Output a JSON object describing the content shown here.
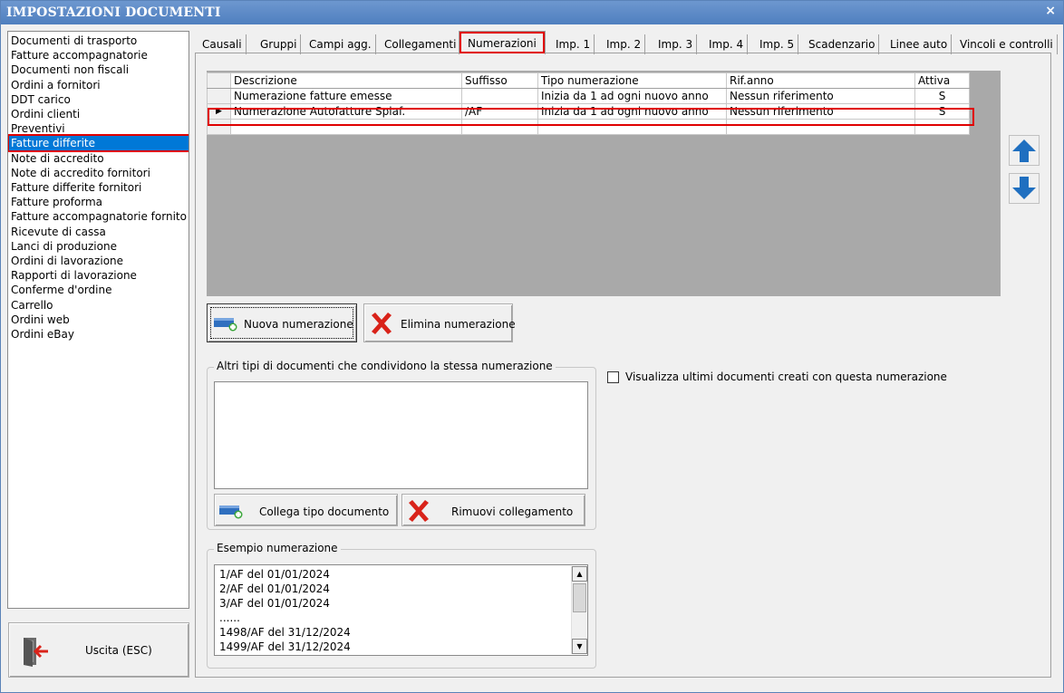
{
  "window": {
    "title": "IMPOSTAZIONI DOCUMENTI",
    "close_glyph": "×"
  },
  "doclist": {
    "items": [
      "Documenti di trasporto",
      "Fatture accompagnatorie",
      "Documenti non fiscali",
      "Ordini a fornitori",
      "DDT carico",
      "Ordini clienti",
      "Preventivi",
      "Fatture differite",
      "Note di accredito",
      "Note di accredito fornitori",
      "Fatture differite fornitori",
      "Fatture proforma",
      "Fatture accompagnatorie fornito",
      "Ricevute di cassa",
      "Lanci di produzione",
      "Ordini di lavorazione",
      "Rapporti di lavorazione",
      "Conferme d'ordine",
      "Carrello",
      "Ordini web",
      "Ordini eBay"
    ],
    "selected": "Fatture differite"
  },
  "exit_button": {
    "label": "Uscita (ESC)",
    "icon": "exit-door-icon"
  },
  "tabs": [
    "Causali",
    "Gruppi",
    "Campi agg.",
    "Collegamenti",
    "Numerazioni",
    "Imp. 1",
    "Imp. 2",
    "Imp. 3",
    "Imp. 4",
    "Imp. 5",
    "Scadenzario",
    "Linee auto",
    "Vincoli e controlli"
  ],
  "active_tab": "Numerazioni",
  "grid": {
    "columns": [
      "Descrizione",
      "Suffisso",
      "Tipo numerazione",
      "Rif.anno",
      "Attiva"
    ],
    "rows": [
      [
        "Numerazione fatture emesse",
        "",
        "Inizia da 1 ad ogni nuovo anno",
        "Nessun riferimento",
        "S"
      ],
      [
        "Numerazione Autofatture Splaf.",
        "/AF",
        "Inizia da 1 ad ogni nuovo anno",
        "Nessun riferimento",
        "S"
      ]
    ],
    "current_row_indicator": "▶"
  },
  "buttons": {
    "new_numbering": "Nuova numerazione",
    "delete_numbering": "Elimina numerazione",
    "link_doc_type": "Collega tipo documento",
    "remove_link": "Rimuovi collegamento"
  },
  "shared_group": {
    "legend": "Altri tipi di documenti che condividono la stessa numerazione",
    "items": []
  },
  "show_latest": {
    "label": "Visualizza ultimi documenti creati con questa numerazione",
    "checked": false
  },
  "example_group": {
    "legend": "Esempio numerazione",
    "lines": [
      "1/AF del 01/01/2024",
      "2/AF del 01/01/2024",
      "3/AF del 01/01/2024",
      "......",
      "1498/AF del 31/12/2024",
      "1499/AF del 31/12/2024"
    ]
  },
  "colors": {
    "title_bar": "#5a86c4",
    "selection": "#0078d7",
    "highlight_annotation": "#e00000",
    "arrow_icon": "#1f6fc0",
    "delete_icon": "#d9231a"
  }
}
